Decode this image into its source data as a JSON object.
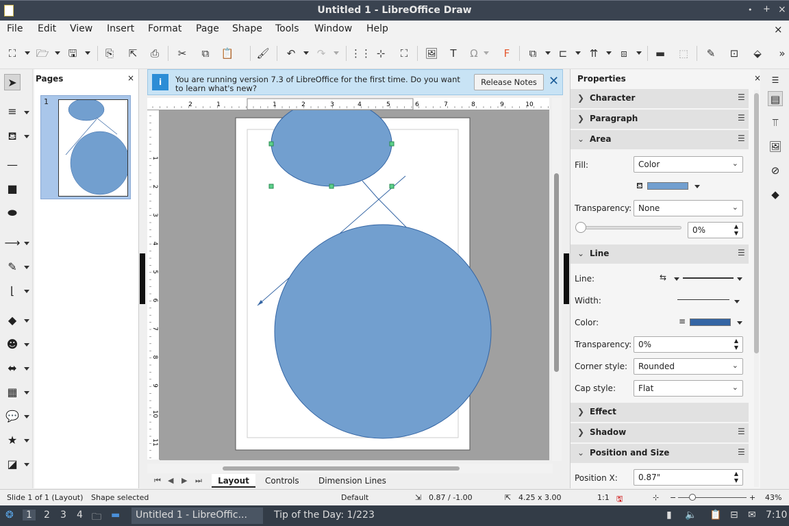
{
  "window": {
    "title": "Untitled 1 - LibreOffice Draw",
    "controls": [
      "•",
      "+",
      "×"
    ]
  },
  "menu": [
    "File",
    "Edit",
    "View",
    "Insert",
    "Format",
    "Page",
    "Shape",
    "Tools",
    "Window",
    "Help"
  ],
  "menu_close": "×",
  "pages_panel": {
    "title": "Pages",
    "close": "×",
    "page_number": "1"
  },
  "infobar": {
    "message": "You are running version 7.3 of LibreOffice for the first time. Do you want to learn what's new?",
    "button": "Release Notes",
    "close": "✕",
    "icon": "i"
  },
  "ruler": {
    "h_ticks": [
      "2",
      "1",
      "1",
      "2",
      "3",
      "4",
      "5",
      "6",
      "7",
      "8",
      "9",
      "10"
    ],
    "v_ticks": [
      "1",
      "2",
      "3",
      "4",
      "5",
      "6",
      "7",
      "8",
      "9",
      "10",
      "11"
    ]
  },
  "tabs": {
    "items": [
      "Layout",
      "Controls",
      "Dimension Lines"
    ],
    "active": "Layout"
  },
  "properties": {
    "title": "Properties",
    "close": "×",
    "sections": {
      "character": "Character",
      "paragraph": "Paragraph",
      "area": "Area",
      "line": "Line",
      "effect": "Effect",
      "shadow": "Shadow",
      "position": "Position and Size"
    },
    "area": {
      "fill_label": "Fill:",
      "fill_value": "Color",
      "fill_color": "#729fcf",
      "transparency_label": "Transparency:",
      "transparency_value": "None",
      "slider_value": "0%"
    },
    "line": {
      "line_label": "Line:",
      "width_label": "Width:",
      "color_label": "Color:",
      "color_value": "#3465a4",
      "transparency_label": "Transparency:",
      "transparency_value": "0%",
      "corner_label": "Corner style:",
      "corner_value": "Rounded",
      "cap_label": "Cap style:",
      "cap_value": "Flat"
    },
    "position": {
      "x_label": "Position X:",
      "x_value": "0.87\""
    }
  },
  "status": {
    "slide": "Slide 1 of 1 (Layout)",
    "selection": "Shape selected",
    "master": "Default",
    "position": "0.87 / -1.00",
    "size": "4.25 x 3.00",
    "scale": "1:1",
    "zoom": "43%"
  },
  "taskbar": {
    "workspaces": [
      "1",
      "2",
      "3",
      "4"
    ],
    "tasks": [
      "Untitled 1 - LibreOffic...",
      "Tip of the Day: 1/223"
    ],
    "clock": "7:10"
  },
  "shape_color": "#729fcf"
}
